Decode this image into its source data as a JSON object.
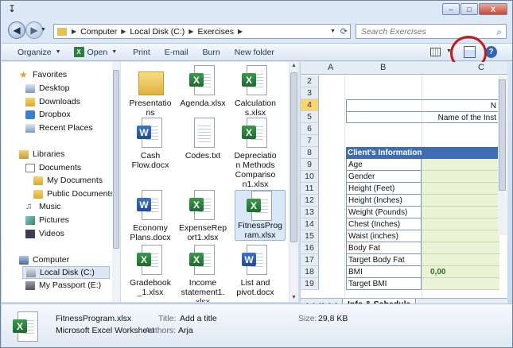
{
  "titlebar": {
    "buttons": {
      "minimize": "–",
      "maximize": "□",
      "close": "X"
    }
  },
  "address": {
    "path": [
      "Computer",
      "Local Disk (C:)",
      "Exercises"
    ]
  },
  "search": {
    "placeholder": "Search Exercises"
  },
  "toolbar": {
    "organize": "Organize",
    "open": "Open",
    "print": "Print",
    "email": "E-mail",
    "burn": "Burn",
    "new_folder": "New folder",
    "help": "?"
  },
  "nav": {
    "favorites": "Favorites",
    "desktop": "Desktop",
    "downloads": "Downloads",
    "dropbox": "Dropbox",
    "recent": "Recent Places",
    "libraries": "Libraries",
    "documents": "Documents",
    "my_documents": "My Documents",
    "public_documents": "Public Documents",
    "music": "Music",
    "pictures": "Pictures",
    "videos": "Videos",
    "computer": "Computer",
    "local_disk": "Local Disk (C:)",
    "passport": "My Passport (E:)"
  },
  "files": [
    {
      "name": "Presentations",
      "type": "folder"
    },
    {
      "name": "Agenda.xlsx",
      "type": "excel"
    },
    {
      "name": "Calculations.xlsx",
      "type": "excel"
    },
    {
      "name": "Cash Flow.docx",
      "type": "word"
    },
    {
      "name": "Codes.txt",
      "type": "text"
    },
    {
      "name": "Depreciation Methods Comparison1.xlsx",
      "type": "excel"
    },
    {
      "name": "Economy Plans.docx",
      "type": "word"
    },
    {
      "name": "ExpenseReport1.xlsx",
      "type": "excel"
    },
    {
      "name": "FitnessProgram.xlsx",
      "type": "excel",
      "selected": true
    },
    {
      "name": "Gradebook_1.xlsx",
      "type": "excel"
    },
    {
      "name": "Income statement1.xlsx",
      "type": "excel"
    },
    {
      "name": "List and pivot.docx",
      "type": "word"
    }
  ],
  "preview": {
    "col_a": "A",
    "col_b": "B",
    "col_c": "C",
    "rows": [
      "2",
      "3",
      "4",
      "5",
      "6",
      "7",
      "8",
      "9",
      "10",
      "11",
      "12",
      "13",
      "14",
      "15",
      "16",
      "17",
      "18",
      "19"
    ],
    "cell_n": "N",
    "institution_label": "Name of the Inst",
    "section_header": "Client's Information",
    "fields": [
      "Age",
      "Gender",
      "Height (Feet)",
      "Height (Inches)",
      "Weight (Pounds)",
      "Chest (Inches)",
      "Waist (inches)",
      "Body Fat",
      "Target Body Fat",
      "BMI",
      "Target BMI"
    ],
    "bmi_value": "0,00",
    "sheet_tab": "Info & Schedule"
  },
  "details": {
    "filename": "FitnessProgram.xlsx",
    "filetype": "Microsoft Excel Worksheet",
    "title_label": "Title:",
    "title_value": "Add a title",
    "authors_label": "Authors:",
    "authors_value": "Arja",
    "size_label": "Size:",
    "size_value": "29,8 KB"
  },
  "colors": {
    "accent": "#2b65b8",
    "annotation": "#c31a1a",
    "excel_green": "#2e7d3e",
    "word_blue": "#2f5fae",
    "selected_row": "#f9d66b"
  }
}
